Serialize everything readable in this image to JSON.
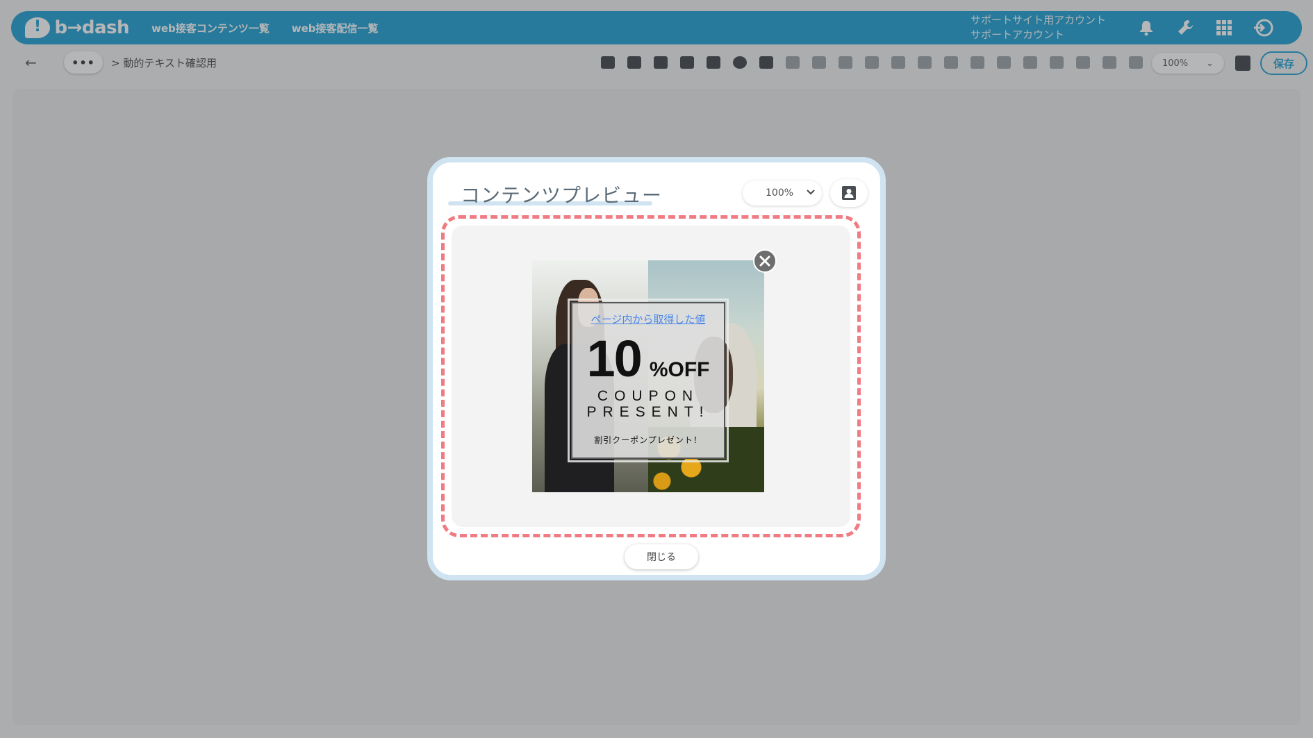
{
  "app": {
    "logo_text": "b→dash",
    "nav": [
      "web接客コンテンツ一覧",
      "web接客配信一覧"
    ],
    "account_line1": "サポートサイト用アカウント",
    "account_line2": "サポートアカウント",
    "icons": [
      "bell-icon",
      "wrench-icon",
      "grid-icon",
      "logout-icon"
    ]
  },
  "toolbar": {
    "back_icon": "←",
    "more_label": "•••",
    "breadcrumb": "> 動的テキスト確認用",
    "zoom": "100%",
    "save_label": "保存"
  },
  "modal": {
    "title": "コンテンツプレビュー",
    "zoom_value": "100%",
    "close_label": "閉じる"
  },
  "coupon": {
    "link_text": "ページ内から取得した値",
    "number": "10",
    "off_text": "%OFF",
    "line1": "COUPON",
    "line2": "PRESENT!",
    "small_text": "割引クーポンプレゼント！"
  }
}
